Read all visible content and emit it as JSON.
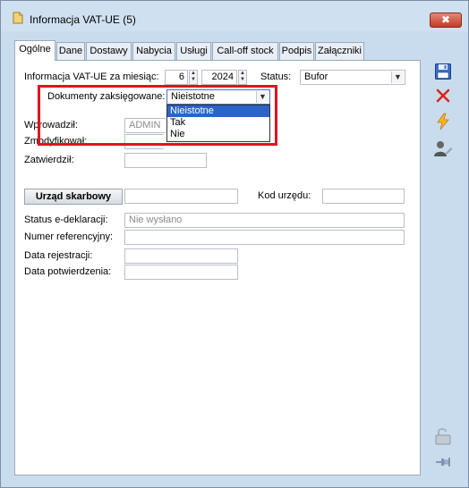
{
  "window": {
    "title": "Informacja VAT-UE (5)",
    "close_label": "✖"
  },
  "tabs": [
    {
      "label": "Ogólne",
      "active": true
    },
    {
      "label": "Dane"
    },
    {
      "label": "Dostawy"
    },
    {
      "label": "Nabycia"
    },
    {
      "label": "Usługi"
    },
    {
      "label": "Call-off stock"
    },
    {
      "label": "Podpis"
    },
    {
      "label": "Załączniki"
    }
  ],
  "form": {
    "month_label": "Informacja VAT-UE za miesiąc:",
    "month_value": "6",
    "year_value": "2024",
    "status_label": "Status:",
    "status_value": "Bufor",
    "docs_label": "Dokumenty zaksięgowane:",
    "docs_value": "Nieistotne",
    "docs_options": [
      "Nieistotne",
      "Tak",
      "Nie"
    ],
    "entered_label": "Wprowadził:",
    "entered_value": "ADMIN",
    "modified_label": "Zmodyfikował:",
    "modified_value": "",
    "approved_label": "Zatwierdził:",
    "approved_value": "",
    "tax_office_button": "Urząd skarbowy",
    "tax_office_value": "",
    "office_code_label": "Kod urzędu:",
    "office_code_value": "",
    "edecl_status_label": "Status e-deklaracji:",
    "edecl_status_value": "Nie wysłano",
    "ref_number_label": "Numer referencyjny:",
    "ref_number_value": "",
    "reg_date_label": "Data rejestracji:",
    "reg_date_value": "",
    "confirm_date_label": "Data potwierdzenia:",
    "confirm_date_value": ""
  },
  "colors": {
    "highlight_border": "#e0141e",
    "selection": "#2a64c9"
  }
}
